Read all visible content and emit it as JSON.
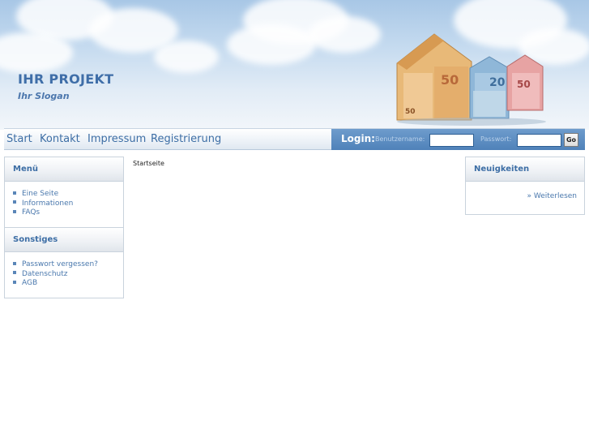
{
  "header": {
    "title": "IHR PROJEKT",
    "slogan": "Ihr Slogan",
    "banknote_values": [
      "50",
      "20",
      "50"
    ]
  },
  "nav": {
    "items": [
      "Start",
      "Kontakt",
      "Impressum",
      "Registrierung"
    ]
  },
  "login": {
    "label": "Login:",
    "username_label": "Benutzername:",
    "password_label": "Passwort:",
    "username_value": "",
    "password_value": "",
    "go_label": "Go"
  },
  "menu_box": {
    "title": "Menü",
    "items": [
      "Eine Seite",
      "Informationen",
      "FAQs"
    ]
  },
  "other_box": {
    "title": "Sonstiges",
    "items": [
      "Passwort vergessen?",
      "Datenschutz",
      "AGB"
    ]
  },
  "content": {
    "breadcrumb": "Startseite"
  },
  "news_box": {
    "title": "Neuigkeiten",
    "more_link": "» Weiterlesen"
  },
  "colors": {
    "accent": "#3d6ea5",
    "login_bar": "#5a8cc2",
    "sky": "#a8c7e6"
  }
}
